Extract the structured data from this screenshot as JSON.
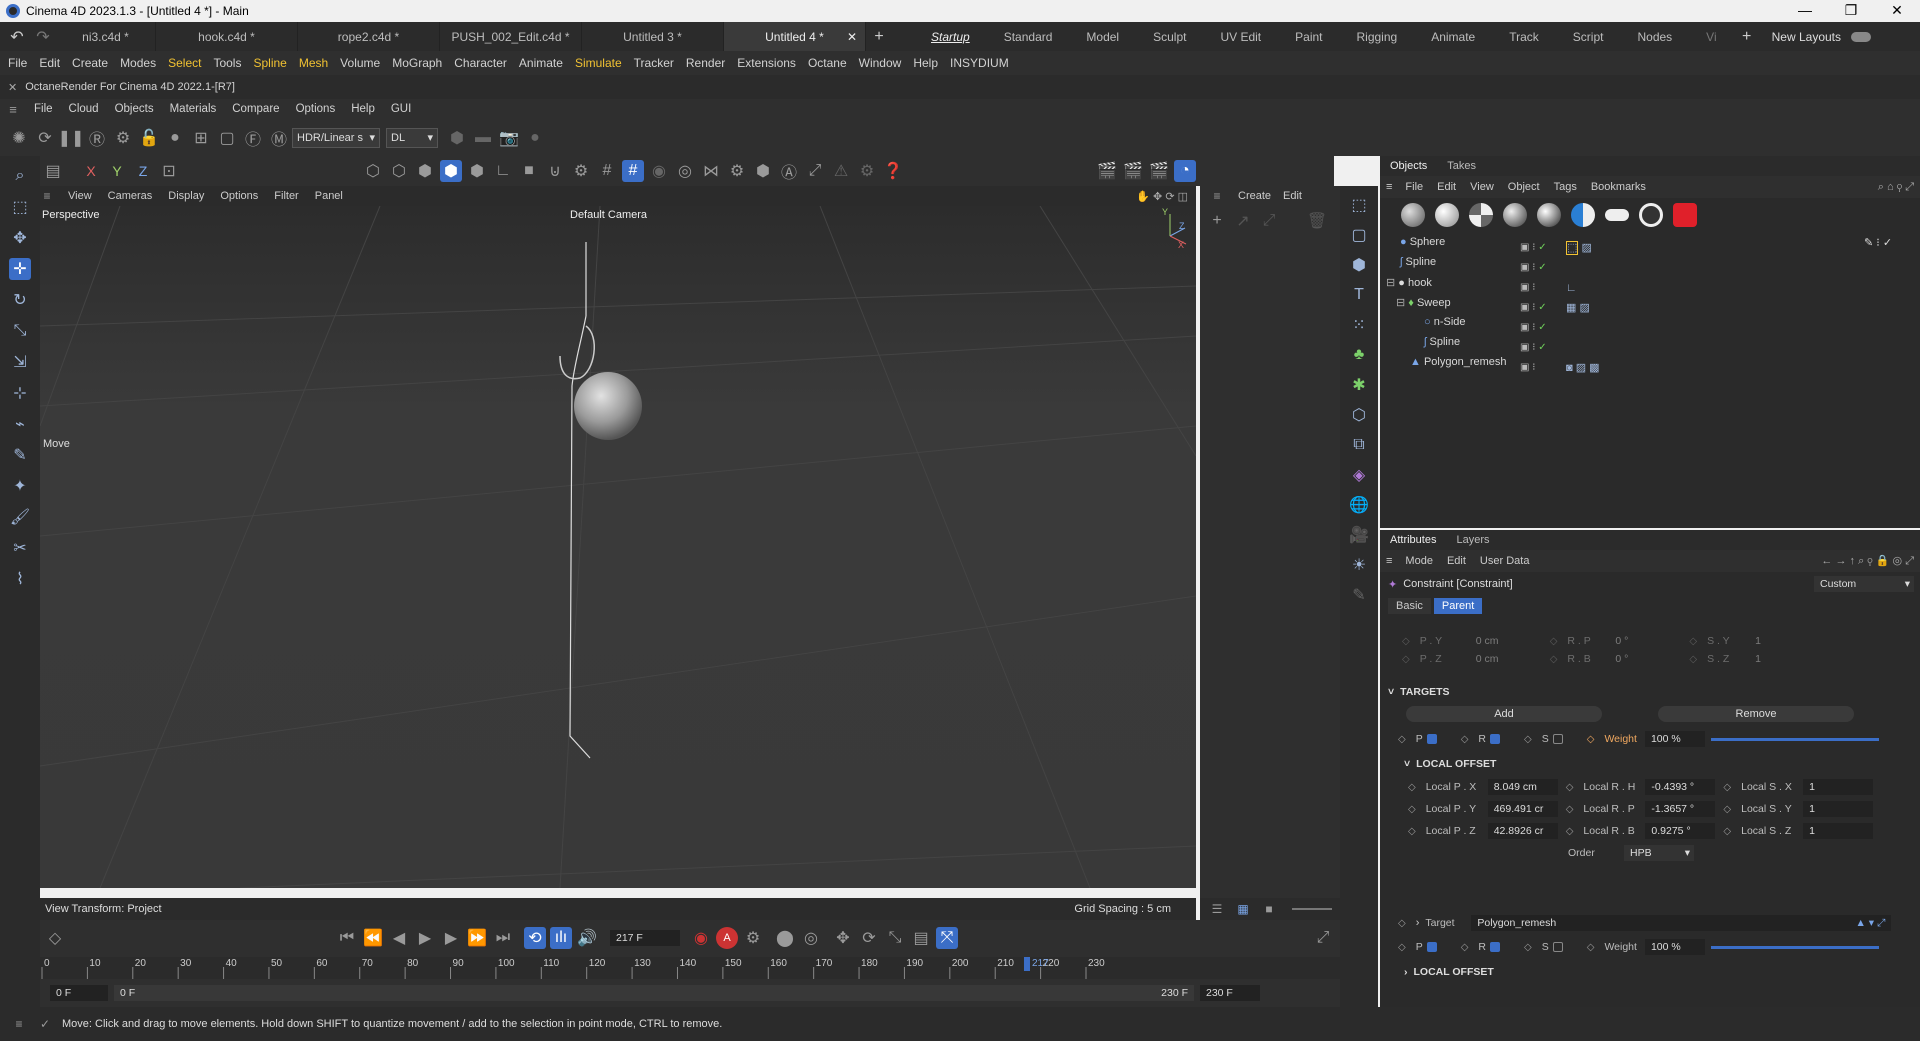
{
  "window": {
    "title": "Cinema 4D 2023.1.3 - [Untitled 4 *] - Main",
    "controls": [
      "—",
      "❐",
      "✕"
    ]
  },
  "doc_tabs": [
    "ni3.c4d *",
    "hook.c4d *",
    "rope2.c4d *",
    "PUSH_002_Edit.c4d *",
    "Untitled 3 *",
    "Untitled 4 *"
  ],
  "layouts": [
    "Startup",
    "Standard",
    "Model",
    "Sculpt",
    "UV Edit",
    "Paint",
    "Rigging",
    "Animate",
    "Track",
    "Script",
    "Nodes",
    "Vi"
  ],
  "new_layouts": "New Layouts",
  "main_menu": [
    "File",
    "Edit",
    "Create",
    "Modes",
    "Select",
    "Tools",
    "Spline",
    "Mesh",
    "Volume",
    "MoGraph",
    "Character",
    "Animate",
    "Simulate",
    "Tracker",
    "Render",
    "Extensions",
    "Octane",
    "Window",
    "Help",
    "INSYDIUM"
  ],
  "octane": {
    "header": "OctaneRender For Cinema 4D 2022.1-[R7]",
    "menu": [
      "File",
      "Cloud",
      "Objects",
      "Materials",
      "Compare",
      "Options",
      "Help",
      "GUI"
    ],
    "hdr_select": "HDR/Linear s",
    "dl_select": "DL"
  },
  "viewport": {
    "menu": [
      "View",
      "Cameras",
      "Display",
      "Options",
      "Filter",
      "Panel"
    ],
    "name": "Perspective",
    "camera": "Default Camera",
    "tool_label": "Move",
    "view_transform": "View Transform: Project",
    "grid_spacing": "Grid Spacing : 5 cm"
  },
  "axes": {
    "x": "X",
    "y": "Y",
    "z": "Z"
  },
  "create_panel": {
    "menu": [
      "Create",
      "Edit"
    ]
  },
  "objects": {
    "tabs": [
      "Objects",
      "Takes"
    ],
    "menu": [
      "File",
      "Edit",
      "View",
      "Object",
      "Tags",
      "Bookmarks"
    ],
    "items": [
      {
        "name": "Sphere",
        "indent": 0
      },
      {
        "name": "Spline",
        "indent": 0
      },
      {
        "name": "hook",
        "indent": 0
      },
      {
        "name": "Sweep",
        "indent": 1
      },
      {
        "name": "n-Side",
        "indent": 2
      },
      {
        "name": "Spline",
        "indent": 2
      },
      {
        "name": "Polygon_remesh",
        "indent": 1
      }
    ]
  },
  "attributes": {
    "tabs": [
      "Attributes",
      "Layers"
    ],
    "menu": [
      "Mode",
      "Edit",
      "User Data"
    ],
    "object_title": "Constraint [Constraint]",
    "preset": "Custom",
    "subtabs": [
      "Basic",
      "Parent"
    ],
    "faded": {
      "py_label": "P . Y",
      "py": "0 cm",
      "rp_label": "R . P",
      "rp": "0 °",
      "sy_label": "S . Y",
      "sy": "1",
      "pz_label": "P . Z",
      "pz": "0 cm",
      "rb_label": "R . B",
      "rb": "0 °",
      "sz_label": "S . Z",
      "sz": "1"
    },
    "targets_header": "TARGETS",
    "add": "Add",
    "remove": "Remove",
    "p": "P",
    "r": "R",
    "s": "S",
    "weight_label": "Weight",
    "weight": "100 %",
    "weight_fraction": 1.0,
    "local_offset_header": "LOCAL OFFSET",
    "offset": {
      "px_label": "Local P . X",
      "px": "8.049 cm",
      "py_label": "Local P . Y",
      "py": "469.491 cr",
      "pz_label": "Local P . Z",
      "pz": "42.8926 cr",
      "rh_label": "Local R . H",
      "rh": "-0.4393 °",
      "rp_label": "Local R . P",
      "rp": "-1.3657 °",
      "rb_label": "Local R . B",
      "rb": "0.9275 °",
      "sx_label": "Local S . X",
      "sx": "1",
      "sy_label": "Local S . Y",
      "sy": "1",
      "sz_label": "Local S . Z",
      "sz": "1",
      "order_label": "Order",
      "order": "HPB"
    },
    "target_label": "Target",
    "target_value": "Polygon_remesh",
    "weight2": "100 %",
    "local_offset_header2": "LOCAL OFFSET"
  },
  "timeline": {
    "current_frame": "217 F",
    "start_field": "0 F",
    "start_field2": "0 F",
    "end_field": "230 F",
    "end_field2": "230 F",
    "ticks": [
      "0",
      "10",
      "20",
      "30",
      "40",
      "50",
      "60",
      "70",
      "80",
      "90",
      "100",
      "110",
      "120",
      "130",
      "140",
      "150",
      "160",
      "170",
      "180",
      "190",
      "200",
      "210",
      "220",
      "230"
    ],
    "playhead_label": "217",
    "playhead_value": 217,
    "range": [
      0,
      230
    ]
  },
  "status": "Move: Click and drag to move elements. Hold down SHIFT to quantize movement / add to the selection in point mode, CTRL to remove.",
  "colors": {
    "accent": "#3b6ec7",
    "highlight": "#f1c232",
    "check": "#6fcf5a",
    "weight": "#f0a860"
  }
}
